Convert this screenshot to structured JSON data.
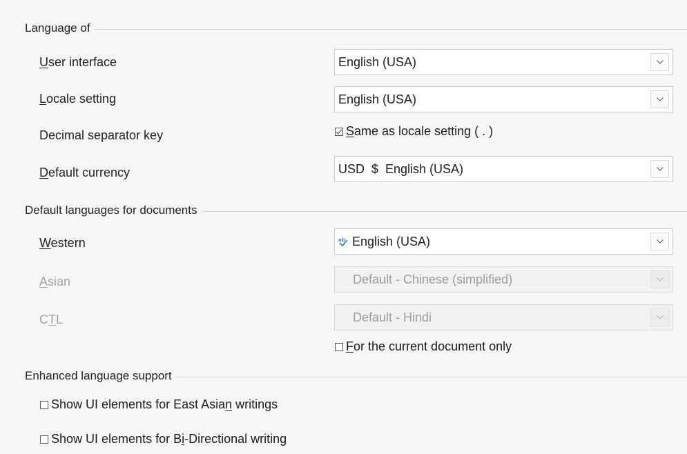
{
  "sections": {
    "language_of": {
      "title": "Language of",
      "user_interface": {
        "label_accel": "U",
        "label_rest": "ser interface",
        "value": "English (USA)"
      },
      "locale_setting": {
        "label_accel": "L",
        "label_rest": "ocale setting",
        "value": "English (USA)"
      },
      "decimal_separator": {
        "label": "Decimal separator key",
        "checkbox_accel": "S",
        "checkbox_rest": "ame as locale setting ( . )",
        "checked": true
      },
      "default_currency": {
        "label_accel": "D",
        "label_rest": "efault currency",
        "value": "USD  $  English (USA)"
      }
    },
    "default_languages": {
      "title": "Default languages for documents",
      "western": {
        "label_accel": "W",
        "label_rest": "estern",
        "value": "English (USA)",
        "icon": "spellcheck-icon"
      },
      "asian": {
        "label_accel": "A",
        "label_rest": "sian",
        "value": "Default - Chinese (simplified)",
        "disabled": true
      },
      "ctl": {
        "label_pre": "C",
        "label_accel": "T",
        "label_rest": "L",
        "value": "Default - Hindi",
        "disabled": true
      },
      "current_doc_only": {
        "accel": "F",
        "rest": "or the current document only",
        "checked": false
      }
    },
    "enhanced": {
      "title": "Enhanced language support",
      "east_asian": {
        "pre": "Show UI elements for East Asia",
        "accel": "n",
        "rest": " writings",
        "checked": false
      },
      "bidi": {
        "pre": "Show UI elements for B",
        "accel": "i",
        "rest": "-Directional writing",
        "checked": false
      }
    }
  },
  "colors": {
    "background": "#f6f6f6",
    "disabled_text": "#a3a3a3",
    "spell_icon": "#3a7bd5"
  }
}
